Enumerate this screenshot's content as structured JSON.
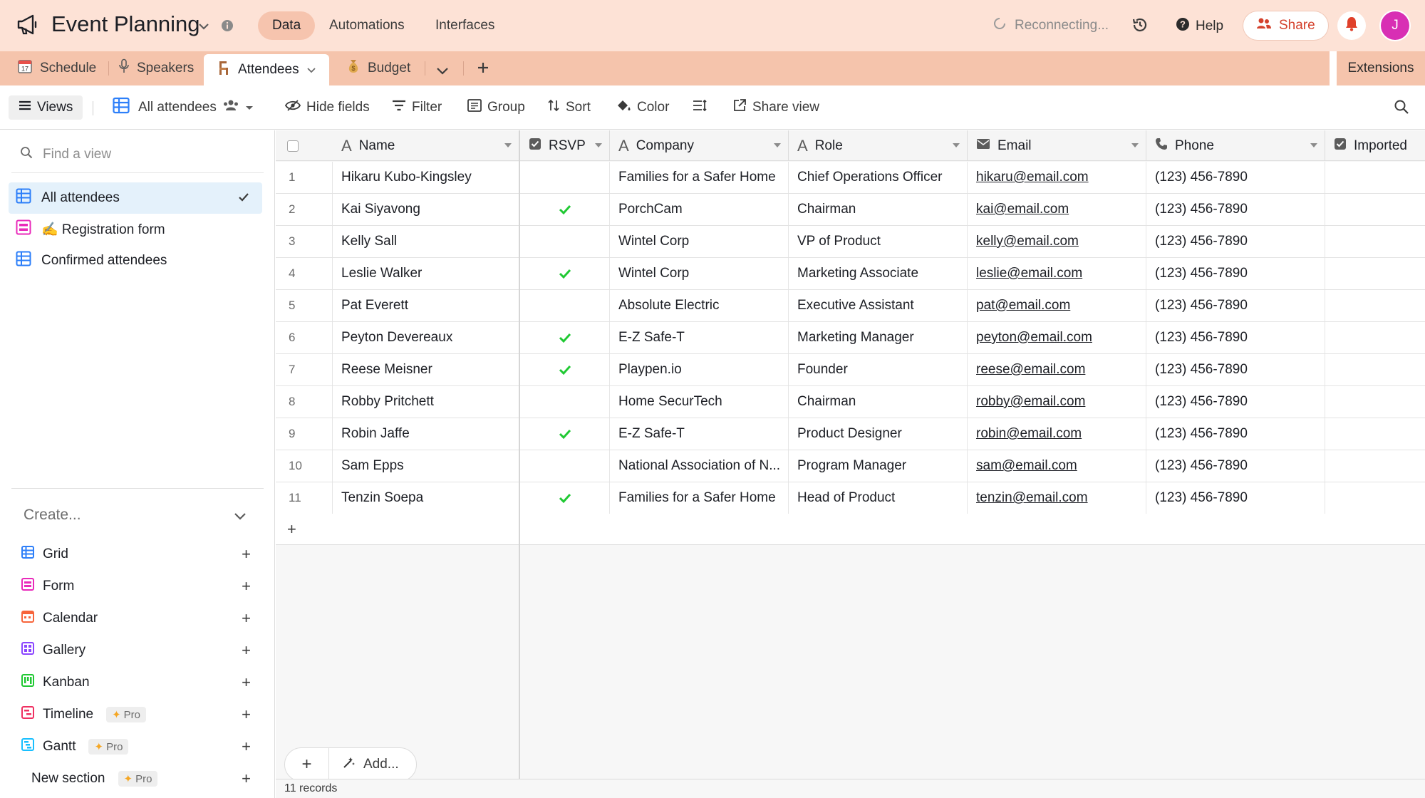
{
  "header": {
    "base_name": "Event Planning",
    "nav": [
      "Data",
      "Automations",
      "Interfaces"
    ],
    "reconnecting": "Reconnecting...",
    "help_label": "Help",
    "share_label": "Share",
    "avatar_initial": "J",
    "accent_color": "#d4412c",
    "avatar_color": "#d82fb4"
  },
  "tabs": {
    "items": [
      {
        "label": "Schedule",
        "icon": "calendar-emoji-icon"
      },
      {
        "label": "Speakers",
        "icon": "microphone-icon"
      },
      {
        "label": "Attendees",
        "icon": "chair-emoji-icon"
      },
      {
        "label": "Budget",
        "icon": "money-bag-emoji-icon"
      }
    ],
    "extensions_label": "Extensions"
  },
  "viewbar": {
    "views_label": "Views",
    "current_view": "All attendees",
    "hide_fields": "Hide fields",
    "filter": "Filter",
    "group": "Group",
    "sort": "Sort",
    "color": "Color",
    "share_view": "Share view"
  },
  "sidebar": {
    "find_placeholder": "Find a view",
    "views": [
      {
        "label": "All attendees"
      },
      {
        "label": "✍️ Registration form"
      },
      {
        "label": "Confirmed attendees"
      }
    ],
    "create_label": "Create...",
    "create_items": [
      {
        "label": "Grid",
        "color": "#2d7ff9"
      },
      {
        "label": "Form",
        "color": "#e929ba"
      },
      {
        "label": "Calendar",
        "color": "#f7653b"
      },
      {
        "label": "Gallery",
        "color": "#8b46ff"
      },
      {
        "label": "Kanban",
        "color": "#20c933"
      },
      {
        "label": "Timeline",
        "color": "#ef3061",
        "badge": "Pro"
      },
      {
        "label": "Gantt",
        "color": "#18bfff",
        "badge": "Pro"
      },
      {
        "label": "New section",
        "badge": "Pro"
      }
    ]
  },
  "grid": {
    "columns": [
      "Name",
      "RSVP",
      "Company",
      "Role",
      "Email",
      "Phone",
      "Imported"
    ],
    "rows": [
      {
        "n": "1",
        "name": "Hikaru Kubo-Kingsley",
        "rsvp": false,
        "company": "Families for a Safer Home",
        "role": "Chief Operations Officer",
        "email": "hikaru@email.com",
        "phone": "(123) 456-7890"
      },
      {
        "n": "2",
        "name": "Kai Siyavong",
        "rsvp": true,
        "company": "PorchCam",
        "role": "Chairman",
        "email": "kai@email.com",
        "phone": "(123) 456-7890"
      },
      {
        "n": "3",
        "name": "Kelly Sall",
        "rsvp": false,
        "company": "Wintel Corp",
        "role": "VP of Product",
        "email": "kelly@email.com",
        "phone": "(123) 456-7890"
      },
      {
        "n": "4",
        "name": "Leslie Walker",
        "rsvp": true,
        "company": "Wintel Corp",
        "role": "Marketing Associate",
        "email": "leslie@email.com",
        "phone": "(123) 456-7890"
      },
      {
        "n": "5",
        "name": "Pat Everett",
        "rsvp": false,
        "company": "Absolute Electric",
        "role": "Executive Assistant",
        "email": "pat@email.com",
        "phone": "(123) 456-7890"
      },
      {
        "n": "6",
        "name": "Peyton Devereaux",
        "rsvp": true,
        "company": "E-Z Safe-T",
        "role": "Marketing Manager",
        "email": "peyton@email.com",
        "phone": "(123) 456-7890"
      },
      {
        "n": "7",
        "name": "Reese Meisner",
        "rsvp": true,
        "company": "Playpen.io",
        "role": "Founder",
        "email": "reese@email.com",
        "phone": "(123) 456-7890"
      },
      {
        "n": "8",
        "name": "Robby Pritchett",
        "rsvp": false,
        "company": "Home SecurTech",
        "role": "Chairman",
        "email": "robby@email.com",
        "phone": "(123) 456-7890"
      },
      {
        "n": "9",
        "name": "Robin Jaffe",
        "rsvp": true,
        "company": "E-Z Safe-T",
        "role": "Product Designer",
        "email": "robin@email.com",
        "phone": "(123) 456-7890"
      },
      {
        "n": "10",
        "name": "Sam Epps",
        "rsvp": false,
        "company": "National Association of N...",
        "role": "Program Manager",
        "email": "sam@email.com",
        "phone": "(123) 456-7890"
      },
      {
        "n": "11",
        "name": "Tenzin Soepa",
        "rsvp": true,
        "company": "Families for a Safer Home",
        "role": "Head of Product",
        "email": "tenzin@email.com",
        "phone": "(123) 456-7890"
      }
    ],
    "add_label": "Add...",
    "record_count": "11 records",
    "check_color": "#20c933"
  }
}
